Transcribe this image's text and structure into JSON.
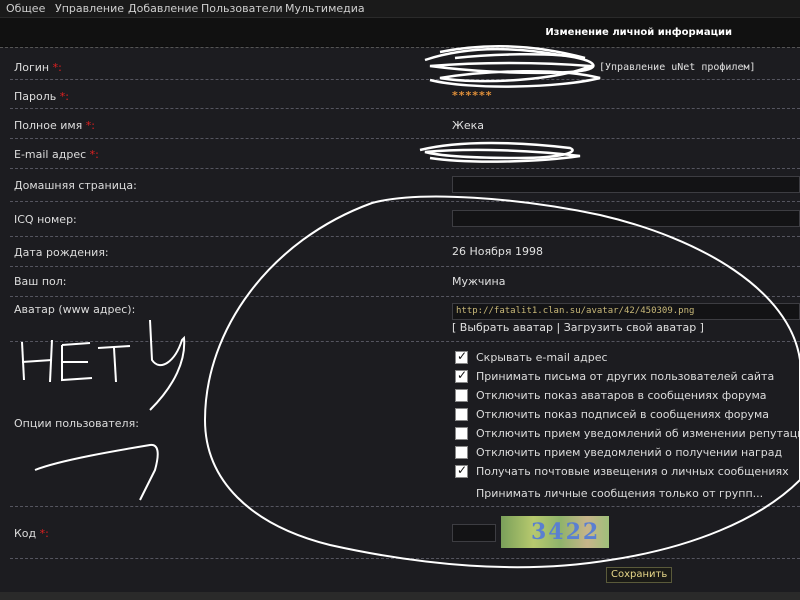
{
  "nav": [
    "Общее",
    "Управление",
    "Добавление",
    "Пользователи",
    "Мультимедиа"
  ],
  "header": {
    "title": "Изменение личной информации"
  },
  "form": {
    "login_label": "Логин",
    "login_link": "[Управление uNet профилем]",
    "password_label": "Пароль",
    "password_value": "******",
    "fullname_label": "Полное имя",
    "fullname_value": "Жека",
    "email_label": "E-mail адрес",
    "homepage_label": "Домашняя страница:",
    "icq_label": "ICQ номер:",
    "birth_label": "Дата рождения:",
    "birth_value": "26 Ноября 1998",
    "gender_label": "Ваш пол:",
    "gender_value": "Мужчина",
    "avatar_label": "Аватар (www адрес):",
    "avatar_url": "http://fatalit1.clan.su/avatar/42/450309.png",
    "avatar_select": "[ Выбрать аватар",
    "avatar_sep": "|",
    "avatar_upload": "Загрузить свой аватар ]",
    "options_label": "Опции пользователя:",
    "code_label": "Код",
    "required_mark": "*:",
    "captcha_text": "3422",
    "save_label": "Сохранить"
  },
  "options": [
    {
      "label": "Скрывать e-mail адрес",
      "checked": true
    },
    {
      "label": "Принимать письма от других пользователей сайта",
      "checked": true
    },
    {
      "label": "Отключить показ аватаров в сообщениях форума",
      "checked": false
    },
    {
      "label": "Отключить показ подписей в сообщениях форума",
      "checked": false
    },
    {
      "label": "Отключить прием уведомлений об изменении репутации",
      "checked": false
    },
    {
      "label": "Отключить прием уведомлений о получении наград",
      "checked": false
    },
    {
      "label": "Получать почтовые извещения о личных сообщениях",
      "checked": true
    }
  ],
  "options_pm_text": "Принимать личные сообщения только от групп..."
}
